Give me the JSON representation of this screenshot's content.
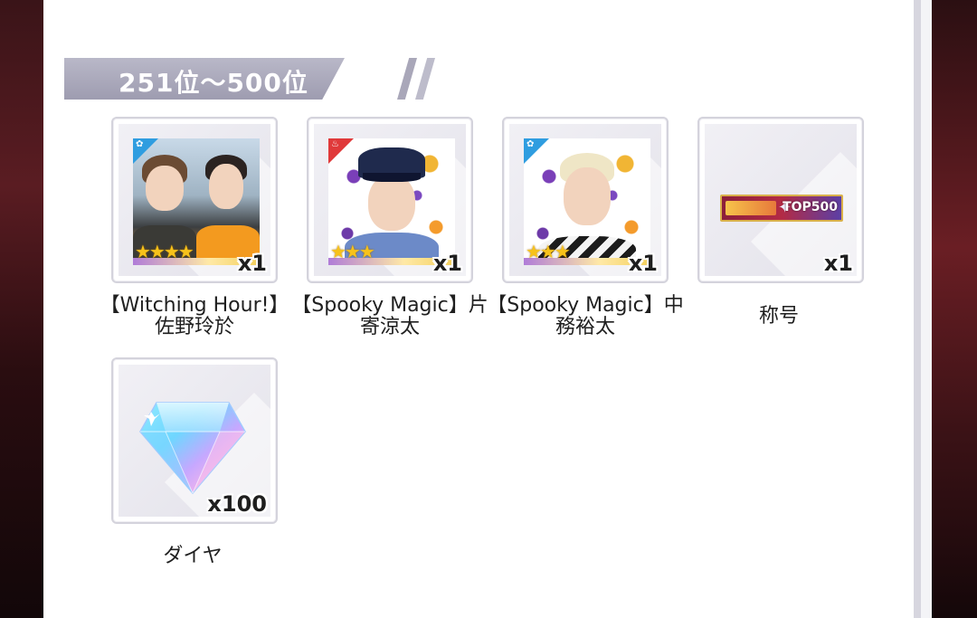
{
  "section": {
    "rank_range": "251位〜500位"
  },
  "rewards": [
    {
      "name": "【Witching Hour!】佐野玲於",
      "quantity": "x1",
      "stars": "★★★★",
      "type": "card"
    },
    {
      "name": "【Spooky Magic】片寄涼太",
      "quantity": "x1",
      "stars": "★★★",
      "type": "card"
    },
    {
      "name": "【Spooky Magic】中務裕太",
      "quantity": "x1",
      "stars": "★★★",
      "type": "card"
    },
    {
      "name": "称号",
      "quantity": "x1",
      "type": "title",
      "plate_text": "TOP500"
    },
    {
      "name": "ダイヤ",
      "quantity": "x100",
      "type": "currency"
    }
  ],
  "colors": {
    "banner": "#a9a7b9",
    "star": "#f7c21a",
    "badge_blue": "#2f9de0",
    "badge_red": "#e0393a"
  },
  "icons": [
    "sakura-type-icon",
    "star-icon",
    "diamond-gem-icon"
  ]
}
